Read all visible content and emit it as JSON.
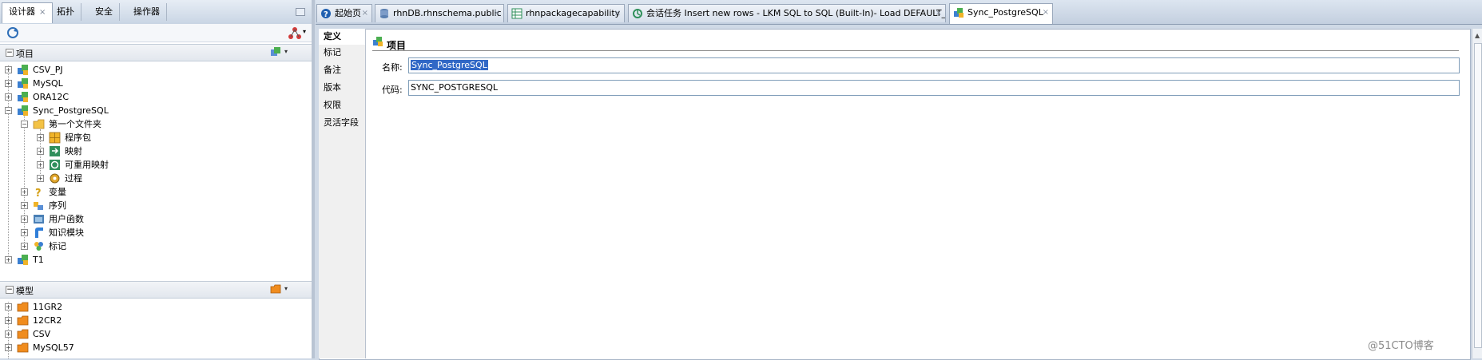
{
  "left_panel": {
    "tabs": [
      {
        "label": "设计器",
        "active": true,
        "close": "×"
      },
      {
        "label": "拓扑",
        "active": false
      },
      {
        "label": "安全",
        "active": false
      },
      {
        "label": "操作器",
        "active": false
      }
    ],
    "projects_section": {
      "title": "项目",
      "tree": [
        {
          "label": "CSV_PJ",
          "icon": "project-icon",
          "expander": "+"
        },
        {
          "label": "MySQL",
          "icon": "project-icon",
          "expander": "+"
        },
        {
          "label": "ORA12C",
          "icon": "project-icon",
          "expander": "+"
        },
        {
          "label": "Sync_PostgreSQL",
          "icon": "project-icon",
          "expander": "−"
        },
        {
          "label": "第一个文件夹",
          "icon": "folder-icon",
          "expander": "−"
        },
        {
          "label": "程序包",
          "icon": "package-icon",
          "expander": "+"
        },
        {
          "label": "映射",
          "icon": "mapping-icon",
          "expander": "+"
        },
        {
          "label": "可重用映射",
          "icon": "reusable-mapping-icon",
          "expander": "+"
        },
        {
          "label": "过程",
          "icon": "procedure-icon",
          "expander": "+"
        },
        {
          "label": "变量",
          "icon": "variable-icon",
          "expander": "+"
        },
        {
          "label": "序列",
          "icon": "sequence-icon",
          "expander": "+"
        },
        {
          "label": "用户函数",
          "icon": "user-function-icon",
          "expander": "+"
        },
        {
          "label": "知识模块",
          "icon": "knowledge-module-icon",
          "expander": "+"
        },
        {
          "label": "标记",
          "icon": "marker-icon",
          "expander": "+"
        },
        {
          "label": "T1",
          "icon": "project-icon",
          "expander": "+"
        }
      ]
    },
    "models_section": {
      "title": "模型",
      "tree": [
        {
          "label": "11GR2",
          "icon": "model-folder-icon",
          "expander": "+"
        },
        {
          "label": "12CR2",
          "icon": "model-folder-icon",
          "expander": "+"
        },
        {
          "label": "CSV",
          "icon": "model-folder-icon",
          "expander": "+"
        },
        {
          "label": "MySQL57",
          "icon": "model-folder-icon",
          "expander": "+"
        }
      ]
    }
  },
  "editor_tabs": [
    {
      "label": "起始页",
      "icon": "help-icon",
      "active": false,
      "close": "×"
    },
    {
      "label": "rhnDB.rhnschema.public",
      "icon": "datastore-icon",
      "active": false,
      "close": "×"
    },
    {
      "label": "rhnpackagecapability",
      "icon": "datastore-table-icon",
      "active": false,
      "close": "×"
    },
    {
      "label": "会话任务 Insert new rows - LKM SQL to SQL (Built-In)- Load DEFAULT_AP",
      "icon": "session-task-icon",
      "active": false,
      "close": "×"
    },
    {
      "label": "Sync_PostgreSQL",
      "icon": "project-icon",
      "active": true,
      "close": "×"
    }
  ],
  "editor": {
    "vertical_tabs": [
      "定义",
      "标记",
      "备注",
      "版本",
      "权限",
      "灵活字段"
    ],
    "active_vertical_tab": "定义",
    "section_title": "项目",
    "fields": {
      "name_label": "名称:",
      "name_value": "Sync_PostgreSQL",
      "code_label": "代码:",
      "code_value": "SYNC_POSTGRESQL"
    }
  },
  "watermark": "@51CTO博客",
  "colors": {
    "selection": "#3168c6",
    "panel_header": "#c9d5e4",
    "tab_border": "#9aa8bb"
  }
}
